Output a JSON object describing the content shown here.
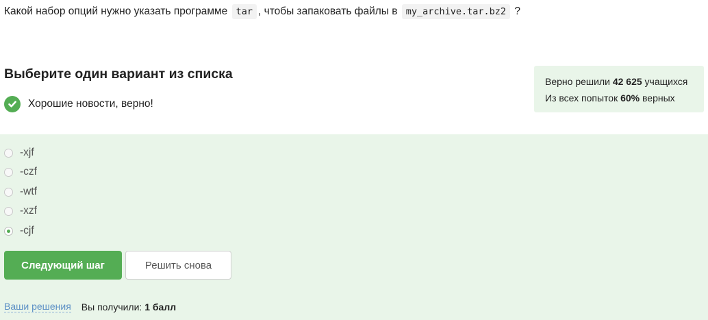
{
  "question": {
    "part1": "Какой набор опций нужно указать программе",
    "code1": "tar",
    "part2": ", чтобы запаковать файлы в",
    "code2": "my_archive.tar.bz2",
    "part3": "?"
  },
  "section_title": "Выберите один вариант из списка",
  "feedback": {
    "icon": "check-icon",
    "text": "Хорошие новости, верно!",
    "color": "#54ad54"
  },
  "stats": {
    "solved_prefix": "Верно решили",
    "solved_count": "42 625",
    "solved_suffix": "учащихся",
    "attempts_prefix": "Из всех попыток",
    "attempts_percent": "60%",
    "attempts_suffix": "верных"
  },
  "options": [
    {
      "label": "-xjf",
      "selected": false
    },
    {
      "label": "-czf",
      "selected": false
    },
    {
      "label": "-wtf",
      "selected": false
    },
    {
      "label": "-xzf",
      "selected": false
    },
    {
      "label": "-cjf",
      "selected": true
    }
  ],
  "buttons": {
    "next": "Следующий шаг",
    "retry": "Решить снова"
  },
  "footer": {
    "solutions_link": "Ваши решения",
    "score_prefix": "Вы получили:",
    "score_value": "1 балл"
  },
  "colors": {
    "accent": "#54ad54",
    "panel_bg": "#e9f5e9",
    "link": "#5b8fc5"
  }
}
